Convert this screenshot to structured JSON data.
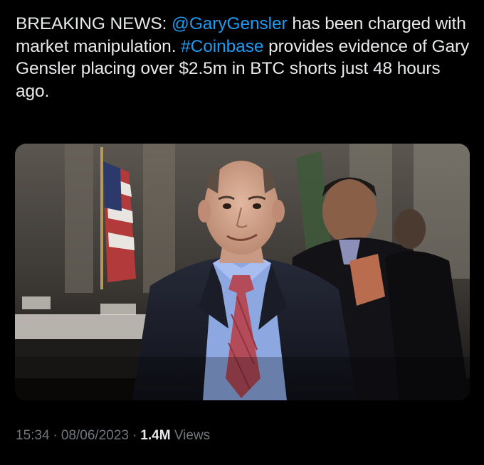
{
  "tweet": {
    "text_parts": {
      "p1": "BREAKING NEWS: ",
      "mention": "@GaryGensler",
      "p2": " has been charged with market manipulation. ",
      "hashtag": "#Coinbase",
      "p3": " provides evidence of Gary Gensler placing over $2.5m in BTC shorts just 48 hours ago."
    },
    "link_color": "#1d9bf0"
  },
  "meta": {
    "time": "15:34",
    "date": "08/06/2023",
    "separator": "·",
    "views_count": "1.4M",
    "views_label": "Views"
  }
}
